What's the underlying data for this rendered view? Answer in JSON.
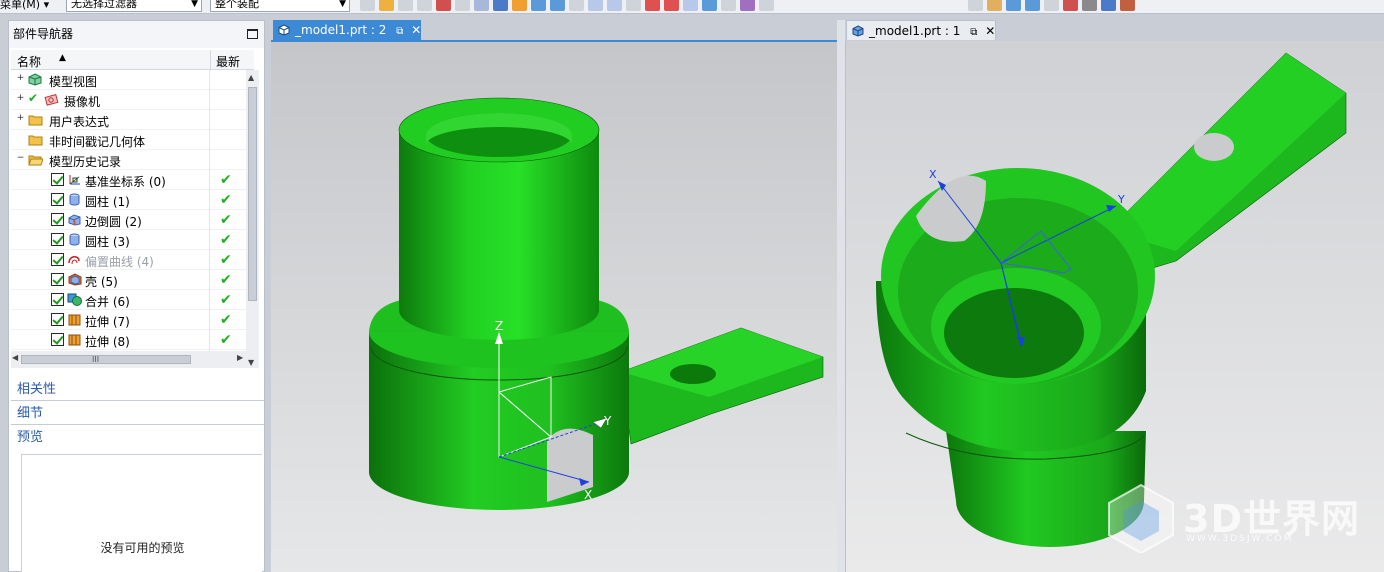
{
  "toolbar": {
    "menu_label": "菜单(M) ▾",
    "filter_combo": "无选择过滤器",
    "assembly_combo": "整个装配"
  },
  "navigator": {
    "title": "部件导航器",
    "col_name": "名称",
    "col_latest": "最新",
    "items": [
      {
        "label": "模型视图",
        "latest": ""
      },
      {
        "label": "摄像机",
        "latest": ""
      },
      {
        "label": "用户表达式",
        "latest": ""
      },
      {
        "label": "非时间戳记几何体",
        "latest": ""
      },
      {
        "label": "模型历史记录",
        "latest": ""
      },
      {
        "label": "基准坐标系 (0)",
        "latest": "✔"
      },
      {
        "label": "圆柱 (1)",
        "latest": "✔"
      },
      {
        "label": "边倒圆 (2)",
        "latest": "✔"
      },
      {
        "label": "圆柱 (3)",
        "latest": "✔"
      },
      {
        "label": "偏置曲线 (4)",
        "latest": "✔"
      },
      {
        "label": "壳 (5)",
        "latest": "✔"
      },
      {
        "label": "合并 (6)",
        "latest": "✔"
      },
      {
        "label": "拉伸 (7)",
        "latest": "✔"
      },
      {
        "label": "拉伸 (8)",
        "latest": "✔"
      }
    ],
    "hscroll_grip": "III"
  },
  "panels": {
    "dependencies": "相关性",
    "details": "细节",
    "preview": "预览",
    "preview_empty": "没有可用的预览"
  },
  "tabs": [
    {
      "label": "_model1.prt : 2",
      "active": true
    },
    {
      "label": "_model1.prt : 1",
      "active": false
    }
  ],
  "viewport1": {
    "axis_x": "X",
    "axis_y": "Y",
    "axis_z": "Z"
  },
  "viewport2": {
    "axis_x": "X",
    "axis_y": "Y"
  },
  "watermark": {
    "text": "3D世界网",
    "url": "WWW.3DSJW.COM"
  },
  "colors": {
    "model": "#1fb81f",
    "tab_active": "#3c8ad6",
    "section_text": "#2a5aa8",
    "check": "#1eae1e"
  }
}
